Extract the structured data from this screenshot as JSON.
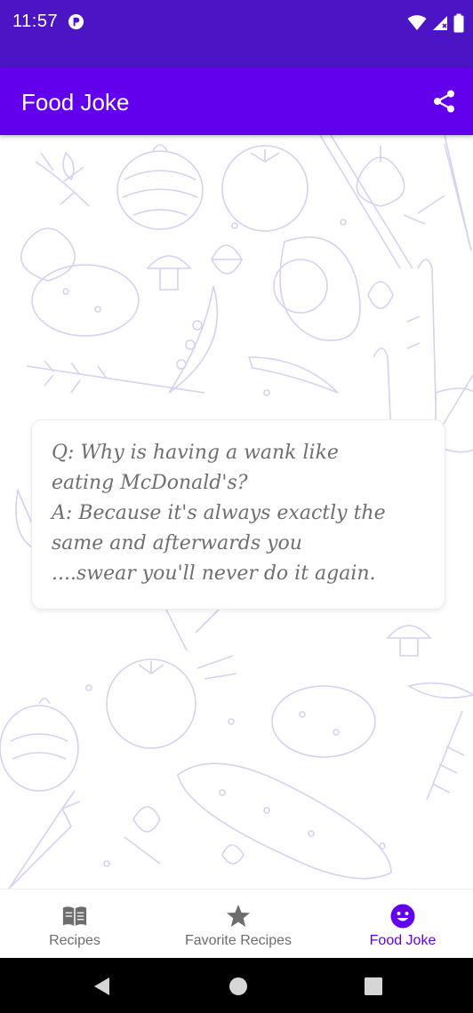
{
  "status_bar": {
    "time": "11:57",
    "app_icon": "app-notification-icon",
    "icons": [
      "wifi-icon",
      "signal-icon",
      "battery-icon"
    ],
    "color": "#4b14c5"
  },
  "app_bar": {
    "title": "Food Joke",
    "share_icon": "share-icon",
    "color": "#6200ee"
  },
  "content": {
    "background_pattern": "food-doodle-pattern",
    "pattern_color": "#dcd3f5",
    "joke": "Q: Why is having a wank like\neating McDonald's?\nA: Because it's always exactly the\nsame and afterwards you\n....swear you'll never do it again."
  },
  "bottom_nav": {
    "items": [
      {
        "label": "Recipes",
        "icon": "book-icon",
        "active": false
      },
      {
        "label": "Favorite Recipes",
        "icon": "star-icon",
        "active": false
      },
      {
        "label": "Food Joke",
        "icon": "smiley-icon",
        "active": true
      }
    ],
    "active_color": "#6200ee",
    "inactive_color": "#6d6d6d"
  },
  "system_nav": {
    "buttons": [
      "back-icon",
      "home-icon",
      "recents-icon"
    ]
  }
}
